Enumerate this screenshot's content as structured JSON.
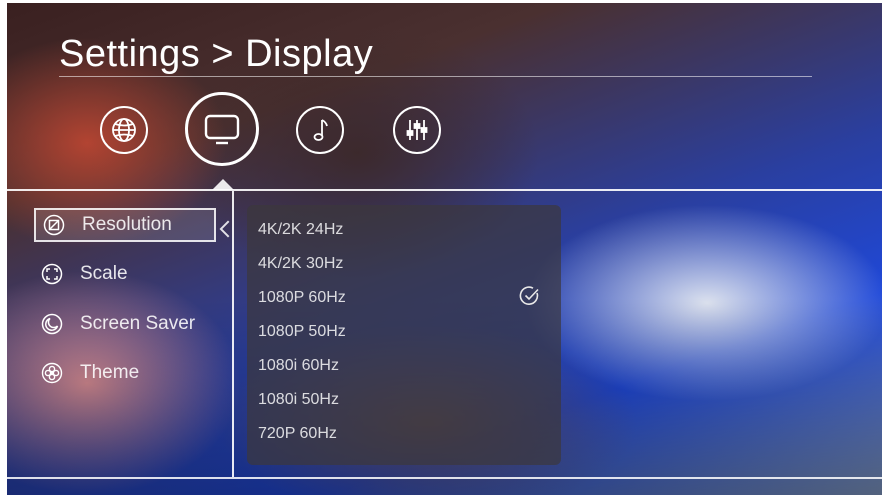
{
  "header": {
    "title": "Settings > Display"
  },
  "categories": [
    {
      "name": "globe-icon",
      "selected": false
    },
    {
      "name": "display-icon",
      "selected": true
    },
    {
      "name": "music-note-icon",
      "selected": false
    },
    {
      "name": "equalizer-icon",
      "selected": false
    }
  ],
  "menu": {
    "items": [
      {
        "label": "Resolution",
        "icon": "resolution-icon",
        "selected": true
      },
      {
        "label": "Scale",
        "icon": "scale-icon",
        "selected": false
      },
      {
        "label": "Screen Saver",
        "icon": "screen-saver-icon",
        "selected": false
      },
      {
        "label": "Theme",
        "icon": "theme-icon",
        "selected": false
      }
    ]
  },
  "resolution_options": {
    "items": [
      {
        "label": "4K/2K 24Hz",
        "checked": false
      },
      {
        "label": "4K/2K 30Hz",
        "checked": false
      },
      {
        "label": "1080P 60Hz",
        "checked": true
      },
      {
        "label": "1080P 50Hz",
        "checked": false
      },
      {
        "label": "1080i 60Hz",
        "checked": false
      },
      {
        "label": "1080i 50Hz",
        "checked": false
      },
      {
        "label": "720P 60Hz",
        "checked": false
      }
    ]
  },
  "colors": {
    "text": "#ffffff",
    "panel": "#3c373c"
  }
}
